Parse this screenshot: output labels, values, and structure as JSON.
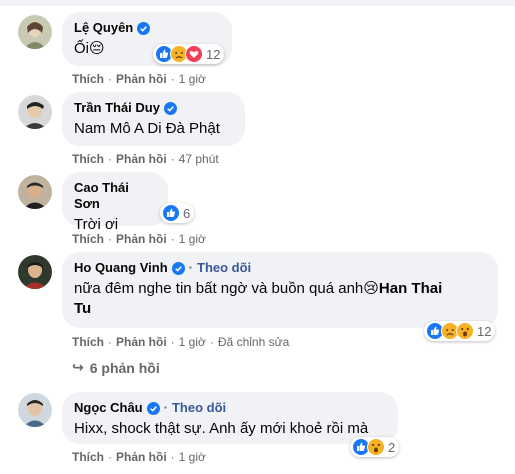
{
  "comments": [
    {
      "name": "Lệ Quyên",
      "verified": true,
      "follow": "",
      "text": "Ối😔",
      "reactions": [
        "like",
        "sad",
        "love"
      ],
      "reaction_count": "12",
      "actions": {
        "like": "Thích",
        "reply": "Phản hồi",
        "time": "1 giờ",
        "edited": ""
      }
    },
    {
      "name": "Trần Thái Duy",
      "verified": true,
      "follow": "",
      "text": "Nam Mô A Di Đà Phật",
      "reactions": [],
      "reaction_count": "",
      "actions": {
        "like": "Thích",
        "reply": "Phản hồi",
        "time": "47 phút",
        "edited": ""
      }
    },
    {
      "name": "Cao Thái Sơn",
      "verified": false,
      "follow": "",
      "text": "Trời ơi",
      "reactions": [
        "like"
      ],
      "reaction_count": "6",
      "actions": {
        "like": "Thích",
        "reply": "Phản hồi",
        "time": "1 giờ",
        "edited": ""
      }
    },
    {
      "name": "Ho Quang Vinh",
      "verified": true,
      "follow": "Theo dõi",
      "text_line1": "nữa đêm nghe tin bất ngờ và buồn quá anh😢",
      "mention": "Han Thai",
      "text_line2": "Tu",
      "reactions": [
        "like",
        "sad",
        "wow"
      ],
      "reaction_count": "12",
      "actions": {
        "like": "Thích",
        "reply": "Phản hồi",
        "time": "1 giờ",
        "edited": "Đã chỉnh sửa"
      }
    },
    {
      "name": "Ngọc Châu",
      "verified": true,
      "follow": "Theo dõi",
      "text": "Hixx, shock thật sự. Anh ấy mới khoẻ rồi mà",
      "reactions": [
        "like",
        "wow"
      ],
      "reaction_count": "2",
      "actions": {
        "like": "Thích",
        "reply": "Phản hồi",
        "time": "1 giờ",
        "edited": ""
      }
    }
  ],
  "replies_link": "6 phản hồi",
  "dot": "·",
  "colors": {
    "bubble": "#f0f2f5",
    "link": "#385898",
    "meta": "#65676b",
    "like_blue": "#1877f2",
    "love_red": "#f33e58",
    "emoji_yellow": "#f7b125"
  }
}
